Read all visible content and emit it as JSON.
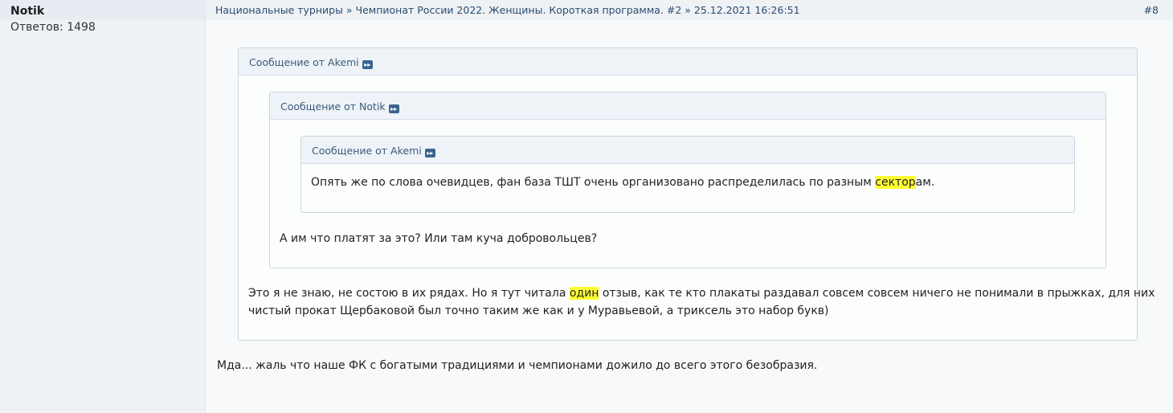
{
  "user": {
    "name": "Notik",
    "replies_label": "Ответов:",
    "replies_count": "1498"
  },
  "post": {
    "breadcrumb": "Национальные турниры » Чемпионат России 2022. Женщины. Короткая программа. #2 » 25.12.2021 16:26:51",
    "number": "#8"
  },
  "quotes": {
    "outer": {
      "header": "Сообщение от Akemi",
      "text_before": "Это я не знаю, не состою в их рядах. Но я тут читала ",
      "highlight": "один",
      "text_after": " отзыв, как те кто плакаты раздавал совсем совсем ничего не понимали в прыжках, для них",
      "text_line2": "чистый прокат Щербаковой был точно таким же как и у Муравьевой, а триксель это набор букв)"
    },
    "middle": {
      "header": "Сообщение от Notik",
      "text": "А им что платят за это? Или там куча добровольцев?"
    },
    "inner": {
      "header": "Сообщение от Akemi",
      "text_before": "Опять же по слова очевидцев, фан база ТШТ очень организовано распределилась по разным ",
      "highlight": "сектор",
      "text_after": "ам."
    }
  },
  "message": "Мда... жаль что наше ФК с богатыми традициями и чемпионами дожило до всего этого безобразия.",
  "icons": {
    "quote_link": "view-post-icon"
  },
  "colors": {
    "link": "#2b4c6f",
    "highlight": "#ffff33",
    "quote_icon": "#3a6590"
  }
}
